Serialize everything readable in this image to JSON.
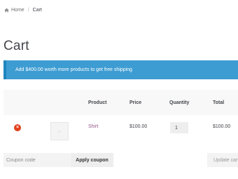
{
  "breadcrumb": {
    "home": "Home",
    "current": "Cart"
  },
  "page": {
    "title": "Cart"
  },
  "notice": {
    "text": "Add $400.00 worth more products to get free shipping"
  },
  "table": {
    "headers": {
      "product": "Product",
      "price": "Price",
      "quantity": "Quantity",
      "total": "Total"
    },
    "rows": [
      {
        "remove": "×",
        "product": "Shirt",
        "price": "$100.00",
        "quantity": "1",
        "total": "$100.00"
      }
    ]
  },
  "coupon": {
    "placeholder": "Coupon code",
    "apply_label": "Apply coupon"
  },
  "actions": {
    "update_label": "Update cart"
  },
  "colors": {
    "notice_bg": "#3d9cd2",
    "remove": "#e2401c",
    "link": "#96588a"
  },
  "icons": {
    "home": "home-icon",
    "remove": "remove-icon"
  }
}
